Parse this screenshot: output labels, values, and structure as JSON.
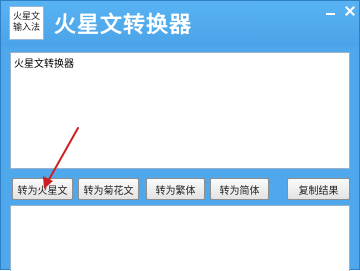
{
  "app": {
    "logo_lines": [
      "火星文",
      "输入法"
    ],
    "title": "火星文转换器"
  },
  "input": {
    "value": "火星文转换器"
  },
  "buttons": {
    "to_huoxing": "转为火星文",
    "to_juhua": "转为菊花文",
    "to_fanti": "转为繁体",
    "to_jianti": "转为简体",
    "copy": "复制结果"
  },
  "output": {
    "value": ""
  },
  "colors": {
    "titlebar": "#4fa8ec",
    "annotation_arrow": "#cc1f1f"
  }
}
